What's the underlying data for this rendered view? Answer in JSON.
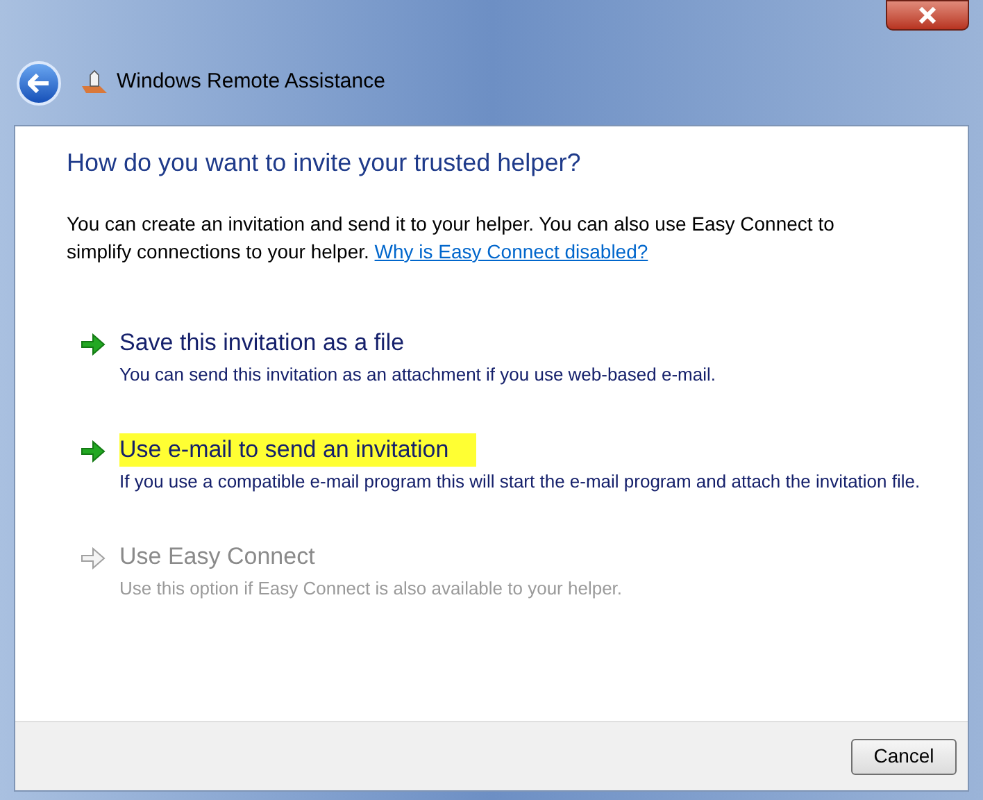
{
  "window": {
    "title": "Windows Remote Assistance"
  },
  "heading": "How do you want to invite your trusted helper?",
  "intro": {
    "text": "You can create an invitation and send it to your helper. You can also use Easy Connect to simplify connections to your helper.",
    "link": "Why is Easy Connect disabled?"
  },
  "options": [
    {
      "title": "Save this invitation as a file",
      "description": "You can send this invitation as an attachment if you use web-based e-mail.",
      "disabled": false,
      "highlighted": false
    },
    {
      "title": "Use e-mail to send an invitation",
      "description": "If you use a compatible e-mail program this will start the e-mail program and attach the invitation file.",
      "disabled": false,
      "highlighted": true
    },
    {
      "title": "Use Easy Connect",
      "description": "Use this option if Easy Connect is also available to your helper.",
      "disabled": true,
      "highlighted": false
    }
  ],
  "buttons": [
    "Cancel"
  ]
}
